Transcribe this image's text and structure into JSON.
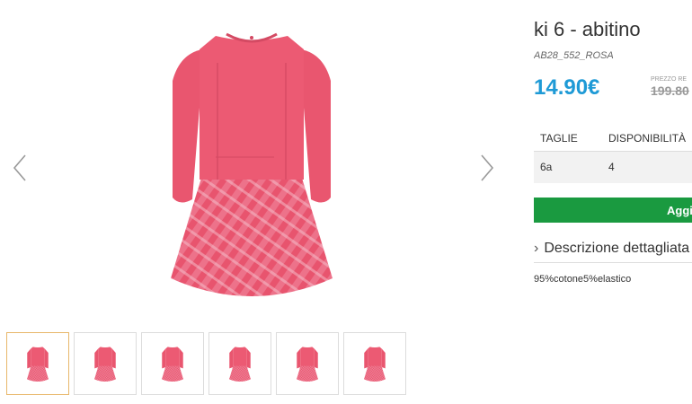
{
  "product": {
    "title": "ki 6 - abitino",
    "sku": "AB28_552_ROSA",
    "price": "14.90€",
    "old_price_label": "PREZZO RE",
    "old_price": "199.80"
  },
  "sizes": {
    "headers": [
      "TAGLIE",
      "DISPONIBILITÀ"
    ],
    "rows": [
      [
        "6a",
        "4"
      ]
    ]
  },
  "actions": {
    "add_label": "Aggiu"
  },
  "description": {
    "toggle_label": "Descrizione dettagliata",
    "text": "95%cotone5%elastico"
  },
  "gallery": {
    "icons": {
      "prev": "chevron-left-icon",
      "next": "chevron-right-icon"
    }
  },
  "colors": {
    "price": "#1e9ad6",
    "button": "#1a9a40",
    "dress": "#e8546e"
  }
}
